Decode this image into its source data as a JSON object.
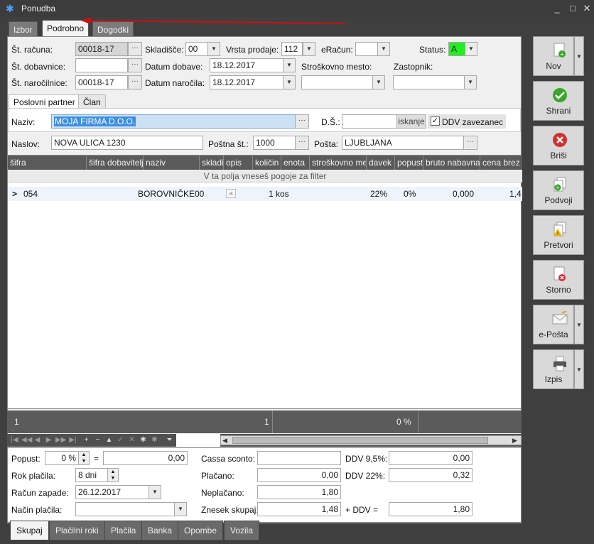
{
  "window": {
    "title": "Ponudba"
  },
  "tabs": [
    "Izbor",
    "Podrobno",
    "Dogodki"
  ],
  "form": {
    "st_racuna_label": "Št. računa:",
    "st_racuna_value": "00018-17",
    "skladisce_label": "Skladišče:",
    "skladisce_value": "00",
    "vrsta_label": "Vrsta prodaje:",
    "vrsta_value": "112",
    "eracun_label": "eRačun:",
    "eracun_value": "",
    "status_label": "Status:",
    "status_value": "A",
    "st_dobavnice_label": "Št. dobavnice:",
    "st_dobavnice_value": "",
    "datum_dobave_label": "Datum dobave:",
    "datum_dobave_value": "18.12.2017",
    "strosk_label": "Stroškovno mesto:",
    "zastopnik_label": "Zastopnik:",
    "st_narocilnice_label": "Št. naročilnice:",
    "st_narocilnice_value": "00018-17",
    "datum_narocila_label": "Datum naročila:",
    "datum_narocila_value": "18.12.2017"
  },
  "partner_tabs": [
    "Poslovni partner",
    "Član"
  ],
  "partner": {
    "naziv_label": "Naziv:",
    "naziv_value": "MOJA FIRMA D.O.O.",
    "ds_label": "D.Š.:",
    "ds_value": "",
    "iskanje": "iskanje",
    "ddv_label": "DDV zavezanec",
    "ddv_check": "✓",
    "naslov_label": "Naslov:",
    "naslov_value": "NOVA ULICA 1230",
    "postna_label": "Poštna št.:",
    "postna_value": "1000",
    "posta_label": "Pošta:",
    "posta_value": "LJUBLJANA"
  },
  "grid": {
    "columns": [
      "šifra",
      "šifra dobavitelj",
      "naziv",
      "skladi",
      "opis",
      "količin",
      "enota",
      "stroškovno me",
      "davek",
      "popust",
      "bruto nabavna",
      "cena brez DD"
    ],
    "filter_hint": "V ta polja vneseš pogoje za filter",
    "row": {
      "expand": ">",
      "sifra": "054",
      "naziv": "BOROVNIČKE",
      "skladisce": "00",
      "opis_icon": "a",
      "kolicina": "1 kos",
      "davek": "22%",
      "popust": "0%",
      "bruto": "0,000",
      "cena": "1,4"
    },
    "footer": {
      "count": "1",
      "qty": "1",
      "popust": "0 %"
    }
  },
  "totals": {
    "popust_label": "Popust:",
    "popust_value": "0 %",
    "eq": "=",
    "popust_amount": "0,00",
    "rok_label": "Rok plačila:",
    "rok_value": "8 dni",
    "zapade_label": "Račun zapade:",
    "zapade_value": "26.12.2017",
    "nacin_label": "Način plačila:",
    "nacin_value": "",
    "cassa_label": "Cassa sconto:",
    "cassa_value": "",
    "placano_label": "Plačano:",
    "placano_value": "0,00",
    "neplacano_label": "Neplačano:",
    "neplacano_value": "1,80",
    "znesek_label": "Znesek skupaj:",
    "znesek_value": "1,48",
    "ddv95_label": "DDV 9,5%:",
    "ddv95_value": "0,00",
    "ddv22_label": "DDV 22%:",
    "ddv22_value": "0,32",
    "plusddv_label": "+ DDV =",
    "plusddv_value": "1,80"
  },
  "bottom_tabs": [
    "Skupaj",
    "Plačilni roki",
    "Plačila",
    "Banka",
    "Opombe",
    "Vozila"
  ],
  "side_buttons": [
    "Nov",
    "Shrani",
    "Briši",
    "Podvoji",
    "Pretvori",
    "Storno",
    "e-Pošta",
    "Izpis"
  ],
  "colors": {
    "status_green": "#22ee22",
    "accent_red": "#cc1111",
    "shrani_green": "#3aa52a",
    "brisi_red": "#d23030"
  }
}
